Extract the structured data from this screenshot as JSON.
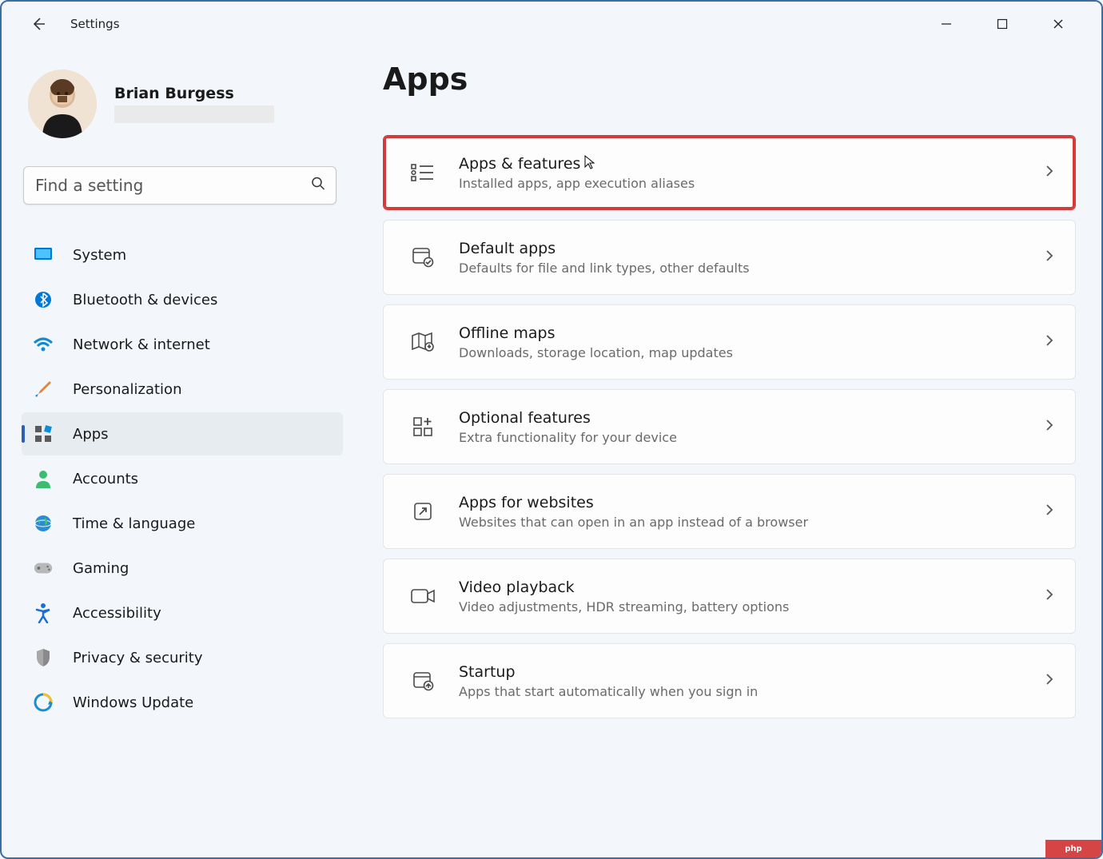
{
  "app_title": "Settings",
  "window_controls": {
    "min": "—",
    "max": "▢",
    "close": "✕"
  },
  "profile": {
    "name": "Brian Burgess"
  },
  "search": {
    "placeholder": "Find a setting"
  },
  "nav": [
    {
      "id": "system",
      "label": "System",
      "icon": "monitor",
      "active": false
    },
    {
      "id": "bluetooth",
      "label": "Bluetooth & devices",
      "icon": "bluetooth",
      "active": false
    },
    {
      "id": "network",
      "label": "Network & internet",
      "icon": "wifi",
      "active": false
    },
    {
      "id": "personalization",
      "label": "Personalization",
      "icon": "brush",
      "active": false
    },
    {
      "id": "apps",
      "label": "Apps",
      "icon": "apps",
      "active": true
    },
    {
      "id": "accounts",
      "label": "Accounts",
      "icon": "person",
      "active": false
    },
    {
      "id": "time",
      "label": "Time & language",
      "icon": "globe",
      "active": false
    },
    {
      "id": "gaming",
      "label": "Gaming",
      "icon": "gamepad",
      "active": false
    },
    {
      "id": "accessibility",
      "label": "Accessibility",
      "icon": "accessibility",
      "active": false
    },
    {
      "id": "privacy",
      "label": "Privacy & security",
      "icon": "shield",
      "active": false
    },
    {
      "id": "update",
      "label": "Windows Update",
      "icon": "update",
      "active": false
    }
  ],
  "page": {
    "title": "Apps"
  },
  "cards": [
    {
      "id": "apps-features",
      "title": "Apps & features",
      "subtitle": "Installed apps, app execution aliases",
      "icon": "list",
      "highlight": true,
      "cursor": true
    },
    {
      "id": "default-apps",
      "title": "Default apps",
      "subtitle": "Defaults for file and link types, other defaults",
      "icon": "default",
      "highlight": false
    },
    {
      "id": "offline-maps",
      "title": "Offline maps",
      "subtitle": "Downloads, storage location, map updates",
      "icon": "map",
      "highlight": false
    },
    {
      "id": "optional-features",
      "title": "Optional features",
      "subtitle": "Extra functionality for your device",
      "icon": "optional",
      "highlight": false
    },
    {
      "id": "apps-websites",
      "title": "Apps for websites",
      "subtitle": "Websites that can open in an app instead of a browser",
      "icon": "web",
      "highlight": false
    },
    {
      "id": "video-playback",
      "title": "Video playback",
      "subtitle": "Video adjustments, HDR streaming, battery options",
      "icon": "video",
      "highlight": false
    },
    {
      "id": "startup",
      "title": "Startup",
      "subtitle": "Apps that start automatically when you sign in",
      "icon": "startup",
      "highlight": false
    }
  ],
  "watermark": "php"
}
